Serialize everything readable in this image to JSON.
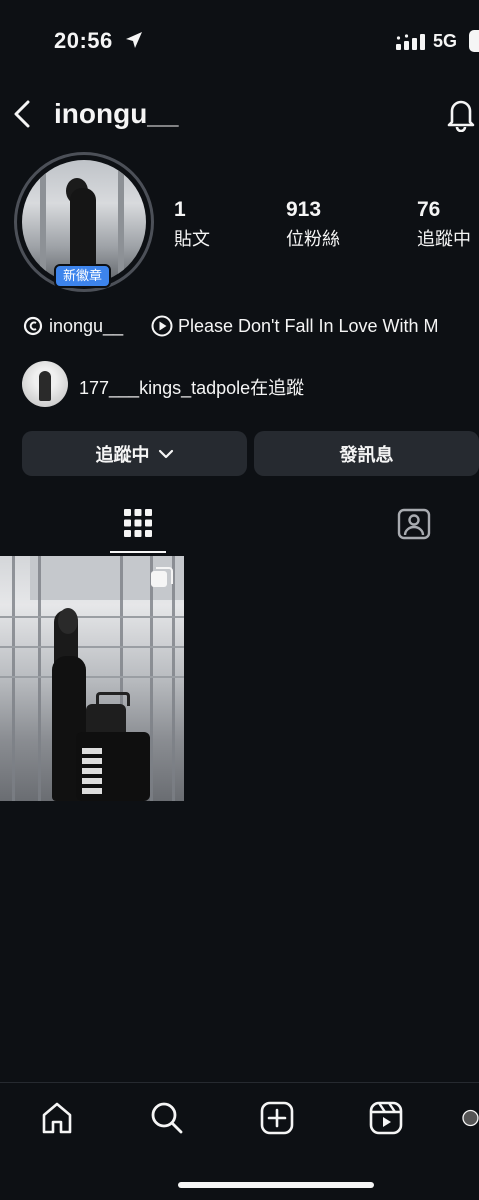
{
  "status_bar": {
    "time": "20:56",
    "network": "5G",
    "location_icon": "location-arrow-icon",
    "signal_icon": "signal-bars-icon",
    "battery_icon": "battery-icon"
  },
  "header": {
    "username": "inongu__",
    "back_icon": "chevron-left-icon",
    "notification_icon": "bell-icon"
  },
  "profile": {
    "badge_label": "新徽章",
    "stats": [
      {
        "value": "1",
        "label": "貼文"
      },
      {
        "value": "913",
        "label": "位粉絲"
      },
      {
        "value": "76",
        "label": "追蹤中"
      }
    ],
    "threads_handle": "inongu__",
    "song": "Please Don't Fall In Love With M",
    "followed_by": "177___kings_tadpole在追蹤"
  },
  "actions": {
    "following_label": "追蹤中",
    "message_label": "發訊息"
  },
  "tabs": [
    {
      "name": "grid",
      "icon": "grid-icon",
      "active": true
    },
    {
      "name": "tagged",
      "icon": "tagged-person-icon",
      "active": false
    }
  ],
  "posts": [
    {
      "type": "carousel",
      "icon": "multiple-posts-icon"
    }
  ],
  "bottom_nav": [
    {
      "name": "home",
      "icon": "home-icon"
    },
    {
      "name": "search",
      "icon": "search-icon"
    },
    {
      "name": "create",
      "icon": "plus-square-icon"
    },
    {
      "name": "reels",
      "icon": "reels-icon"
    },
    {
      "name": "profile",
      "icon": "profile-avatar-icon"
    }
  ],
  "colors": {
    "background": "#0d1014",
    "button": "#262a30",
    "badge": "#3d84ec",
    "text": "#f5f5f5"
  }
}
